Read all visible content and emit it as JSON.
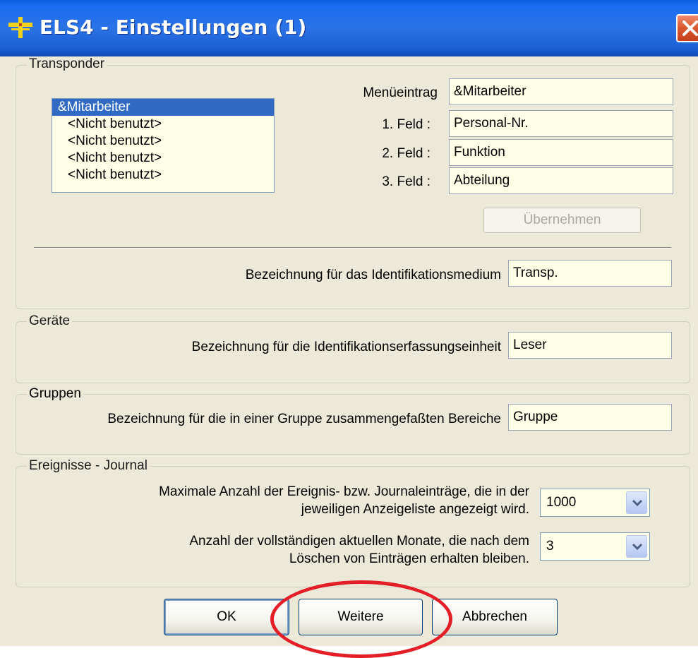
{
  "window": {
    "title": "ELS4 - Einstellungen (1)"
  },
  "transponder": {
    "legend": "Transponder",
    "list_items": [
      {
        "label": "&Mitarbeiter",
        "selected": true
      },
      {
        "label": "<Nicht benutzt>",
        "selected": false
      },
      {
        "label": "<Nicht benutzt>",
        "selected": false
      },
      {
        "label": "<Nicht benutzt>",
        "selected": false
      },
      {
        "label": "<Nicht benutzt>",
        "selected": false
      }
    ],
    "menu_entry_label": "Menüeintrag",
    "menu_entry_value": "&Mitarbeiter",
    "field1_label": "1. Feld :",
    "field1_value": "Personal-Nr.",
    "field2_label": "2. Feld :",
    "field2_value": "Funktion",
    "field3_label": "3. Feld :",
    "field3_value": "Abteilung",
    "apply_button": "Übernehmen",
    "id_medium_label": "Bezeichnung für das Identifikationsmedium",
    "id_medium_value": "Transp."
  },
  "devices": {
    "legend": "Geräte",
    "label": "Bezeichnung für die Identifikationserfassungseinheit",
    "value": "Leser"
  },
  "groups": {
    "legend": "Gruppen",
    "label": "Bezeichnung für die in einer Gruppe zusammengefaßten Bereiche",
    "value": "Gruppe"
  },
  "journal": {
    "legend": "Ereignisse - Journal",
    "max_label_line1": "Maximale Anzahl der Ereignis- bzw. Journaleinträge, die in der",
    "max_label_line2": "jeweiligen Anzeigeliste angezeigt wird.",
    "max_value": "1000",
    "months_label_line1": "Anzahl der vollständigen aktuellen Monate, die nach dem",
    "months_label_line2": "Löschen von Einträgen erhalten bleiben.",
    "months_value": "3"
  },
  "buttons": {
    "ok": "OK",
    "more": "Weitere",
    "cancel": "Abbrechen"
  },
  "colors": {
    "titlebar": "#2b73e6",
    "client_bg": "#ece9d8",
    "field_bg": "#ffffe8",
    "selection": "#316ac5",
    "highlight": "#e41e26"
  }
}
